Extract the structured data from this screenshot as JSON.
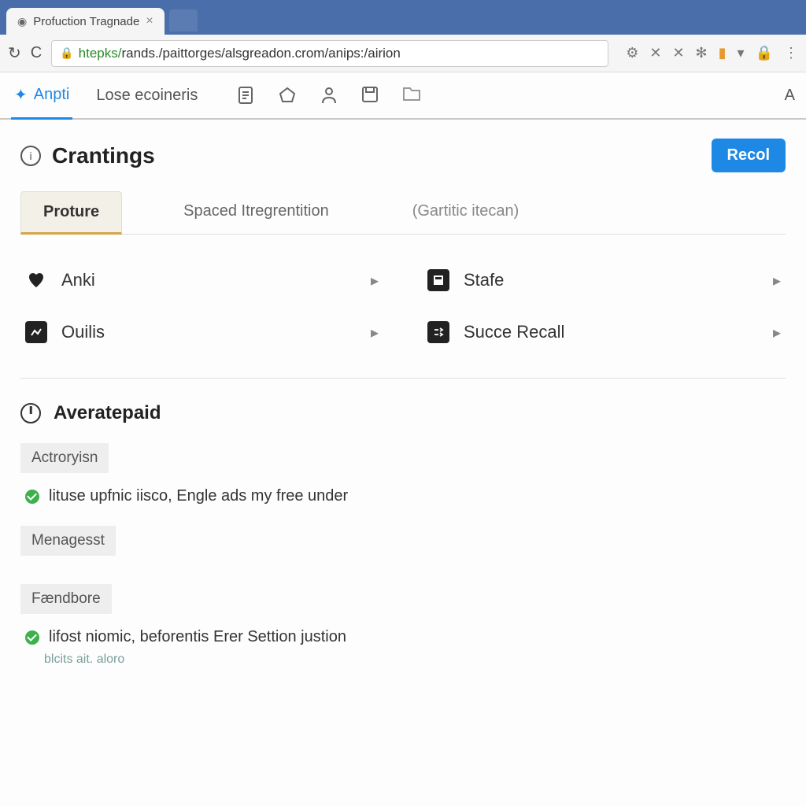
{
  "browser": {
    "tab_title": "Profuction Tragnade",
    "url_proto": "htepks/",
    "url_rest": "rands./paittorges/alsgreadon.crom/anips:/airion"
  },
  "app_toolbar": {
    "tab_active": "Anpti",
    "tab_secondary": "Lose ecoineris",
    "right_label": "A"
  },
  "page": {
    "title": "Crantings",
    "button": "Recol"
  },
  "content_tabs": {
    "t1": "Proture",
    "t2": "Spaced Itregrentition",
    "t3": "(Gartitic itecan)"
  },
  "items": {
    "anki": "Anki",
    "ouilis": "Ouilis",
    "stafe": "Stafe",
    "succe": "Succe Recall"
  },
  "section": {
    "title": "Averatepaid"
  },
  "subs": {
    "s1_head": "Actroryisn",
    "s1_text": "lituse upfnic iisco, Engle ads my free under",
    "s2_head": "Menagesst",
    "s3_head": "Fændbore",
    "s3_text": "lifost niomic, beforentis Erer Settion justion",
    "s3_note": "blcits ait. aloro"
  },
  "colors": {
    "accent": "#1e88e5",
    "chrome": "#4a6ea9"
  }
}
